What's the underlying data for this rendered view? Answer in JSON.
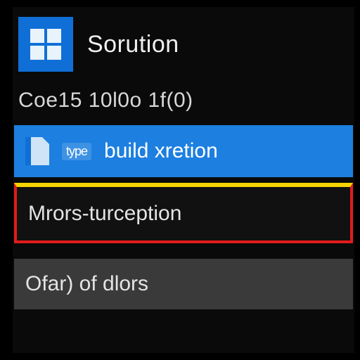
{
  "header": {
    "title": "Sorution",
    "logo_icon": "windows-logo"
  },
  "status_line": "Coe15 10l0o 1f(0)",
  "rows": {
    "build": {
      "badge": "type",
      "label": "build xretion"
    },
    "error": {
      "label": "Mrors-turception"
    },
    "output": {
      "label": "Ofar) of dlors"
    }
  }
}
